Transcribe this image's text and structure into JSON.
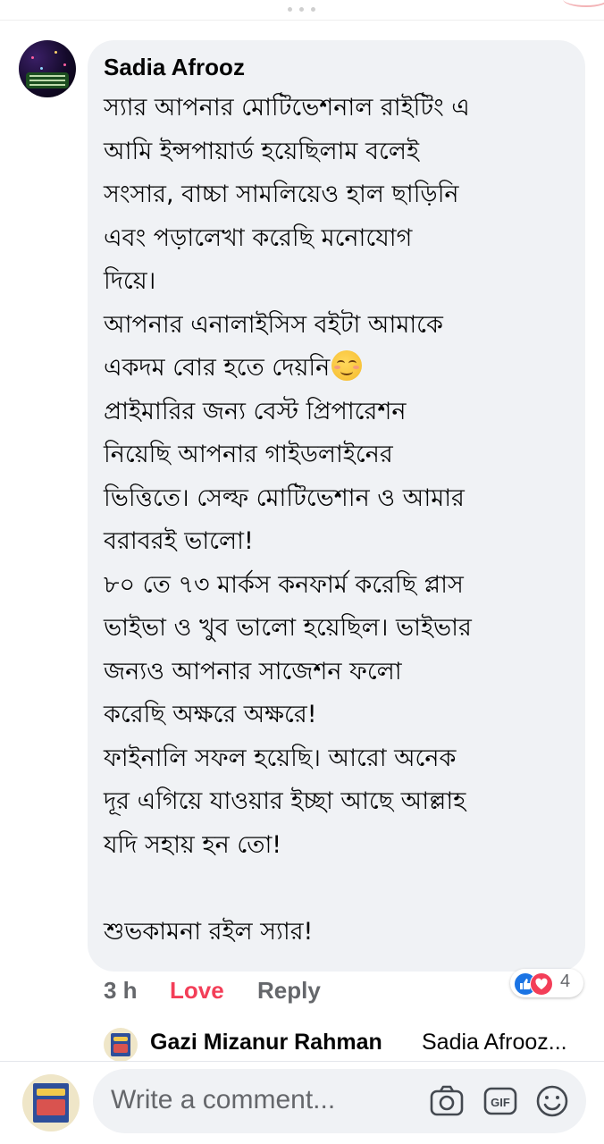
{
  "comment": {
    "author": "Sadia Afrooz",
    "lines": [
      "স্যার আপনার মোটিভেশনাল রাইটিং এ",
      "আমি ইন্সপায়ার্ড হয়েছিলাম বলেই",
      "সংসার, বাচ্চা সামলিয়েও হাল ছাড়িনি",
      "এবং পড়ালেখা করেছি মনোযোগ",
      "দিয়ে।",
      "আপনার এনালাইসিস বইটা আমাকে",
      "একদম বোর হতে দেয়নি",
      "প্রাইমারির জন্য বেস্ট প্রিপারেশন",
      "নিয়েছি আপনার গাইডলাইনের",
      "ভিত্তিতে। সেল্ফ মোটিভেশান ও আমার",
      "বরাবরই ভালো!",
      "৮০ তে ৭৩ মার্কস কনফার্ম করেছি প্লাস",
      "ভাইভা ও খুব ভালো হয়েছিল। ভাইভার",
      "জন্যও আপনার সাজেশন ফলো",
      "করেছি অক্ষরে অক্ষরে!",
      "ফাইনালি সফল হয়েছি। আরো অনেক",
      "দূর এগিয়ে যাওয়ার ইচ্ছা আছে আল্লাহ",
      "যদি সহায় হন তো!",
      "",
      "শুভকামনা রইল স্যার!"
    ],
    "emoji_after_line": 6,
    "emoji_icon": "smiling-face-icon",
    "time": "3 h",
    "love_label": "Love",
    "reply_label": "Reply",
    "reaction_count": "4",
    "reaction_icons": [
      "like-icon",
      "love-icon"
    ]
  },
  "reply_preview": {
    "author": "Gazi Mizanur Rahman",
    "snippet": "Sadia Afrooz..."
  },
  "composer": {
    "placeholder": "Write a comment...",
    "icons": [
      "camera-icon",
      "gif-icon",
      "emoji-icon"
    ]
  },
  "colors": {
    "bubble": "#f0f2f5",
    "meta_gray": "#65676b",
    "love_red": "#f33e58",
    "like_blue": "#1b74e4"
  }
}
